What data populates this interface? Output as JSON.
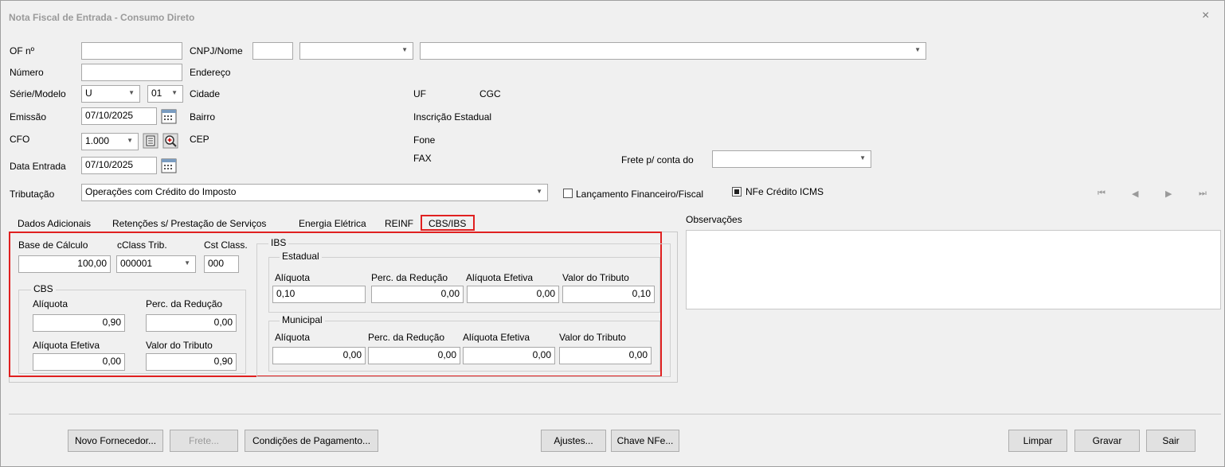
{
  "window": {
    "title": "Nota Fiscal de Entrada - Consumo Direto",
    "close": "×"
  },
  "header": {
    "of_label": "OF nº",
    "of_value": "",
    "numero_label": "Número",
    "numero_value": "",
    "serie_label": "Série/Modelo",
    "serie_value": "U",
    "modelo_value": "01",
    "emissao_label": "Emissão",
    "emissao_value": "07/10/2025",
    "cfo_label": "CFO",
    "cfo_value": "1.000",
    "data_entrada_label": "Data Entrada",
    "data_entrada_value": "07/10/2025",
    "tributacao_label": "Tributação",
    "tributacao_value": "Operações com Crédito do Imposto",
    "cnpj_label": "CNPJ/Nome",
    "cnpj_value": "",
    "cnpj_combo_value": "",
    "nome_value": "",
    "endereco_label": "Endereço",
    "cidade_label": "Cidade",
    "bairro_label": "Bairro",
    "cep_label": "CEP",
    "uf_label": "UF",
    "cgc_label": "CGC",
    "ie_label": "Inscrição Estadual",
    "fone_label": "Fone",
    "fax_label": "FAX",
    "frete_label": "Frete p/ conta do",
    "frete_value": "",
    "lancamento_label": "Lançamento Financeiro/Fiscal",
    "lancamento_checked": false,
    "nfe_credito_label": "NFe Crédito ICMS",
    "nfe_credito_checked": true
  },
  "nav": {
    "first": "⏮",
    "prev": "◀",
    "next": "▶",
    "last": "⏭"
  },
  "tabs": [
    "Dados Adicionais",
    "Retenções s/ Prestação de Serviços",
    "Energia Elétrica",
    "REINF",
    "CBS/IBS"
  ],
  "active_tab": "CBS/IBS",
  "observacoes_label": "Observações",
  "cbs_ibs": {
    "base_calculo_label": "Base de Cálculo",
    "base_calculo_value": "100,00",
    "cclass_label": "cClass Trib.",
    "cclass_value": "000001",
    "cst_label": "Cst Class.",
    "cst_value": "000",
    "cbs": {
      "title": "CBS",
      "aliquota_label": "Alíquota",
      "aliquota_value": "0,90",
      "perc_reducao_label": "Perc. da Redução",
      "perc_reducao_value": "0,00",
      "aliquota_efetiva_label": "Alíquota Efetiva",
      "aliquota_efetiva_value": "0,00",
      "valor_tributo_label": "Valor do Tributo",
      "valor_tributo_value": "0,90"
    },
    "ibs": {
      "title": "IBS",
      "estadual": {
        "title": "Estadual",
        "aliquota_label": "Alíquota",
        "aliquota_value": "0,10",
        "perc_reducao_label": "Perc. da Redução",
        "perc_reducao_value": "0,00",
        "aliquota_efetiva_label": "Alíquota Efetiva",
        "aliquota_efetiva_value": "0,00",
        "valor_tributo_label": "Valor do Tributo",
        "valor_tributo_value": "0,10"
      },
      "municipal": {
        "title": "Municipal",
        "aliquota_label": "Alíquota",
        "aliquota_value": "0,00",
        "perc_reducao_label": "Perc. da Redução",
        "perc_reducao_value": "0,00",
        "aliquota_efetiva_label": "Alíquota Efetiva",
        "aliquota_efetiva_value": "0,00",
        "valor_tributo_label": "Valor do Tributo",
        "valor_tributo_value": "0,00"
      }
    }
  },
  "buttons": {
    "novo_fornecedor": "Novo Fornecedor...",
    "frete": "Frete...",
    "condicoes": "Condições de Pagamento...",
    "ajustes": "Ajustes...",
    "chave_nfe": "Chave NFe...",
    "limpar": "Limpar",
    "gravar": "Gravar",
    "sair": "Sair"
  },
  "highlight_color": "#e02020"
}
